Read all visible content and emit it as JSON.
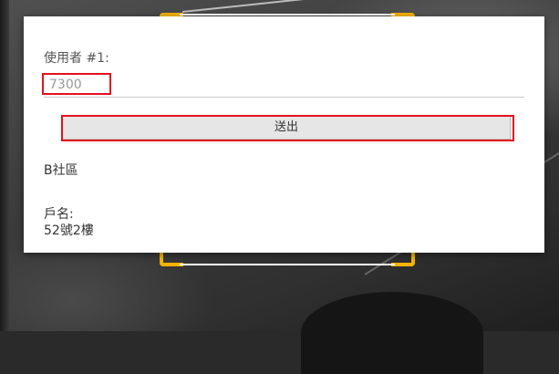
{
  "form": {
    "user_label": "使用者 #1:",
    "user_value": "7300",
    "submit_label": "送出"
  },
  "info": {
    "community": "B社區",
    "household_label": "戶名:",
    "household_value": "52號2樓"
  },
  "colors": {
    "highlight": "#e3101e",
    "scan_corner": "#f5b400"
  }
}
